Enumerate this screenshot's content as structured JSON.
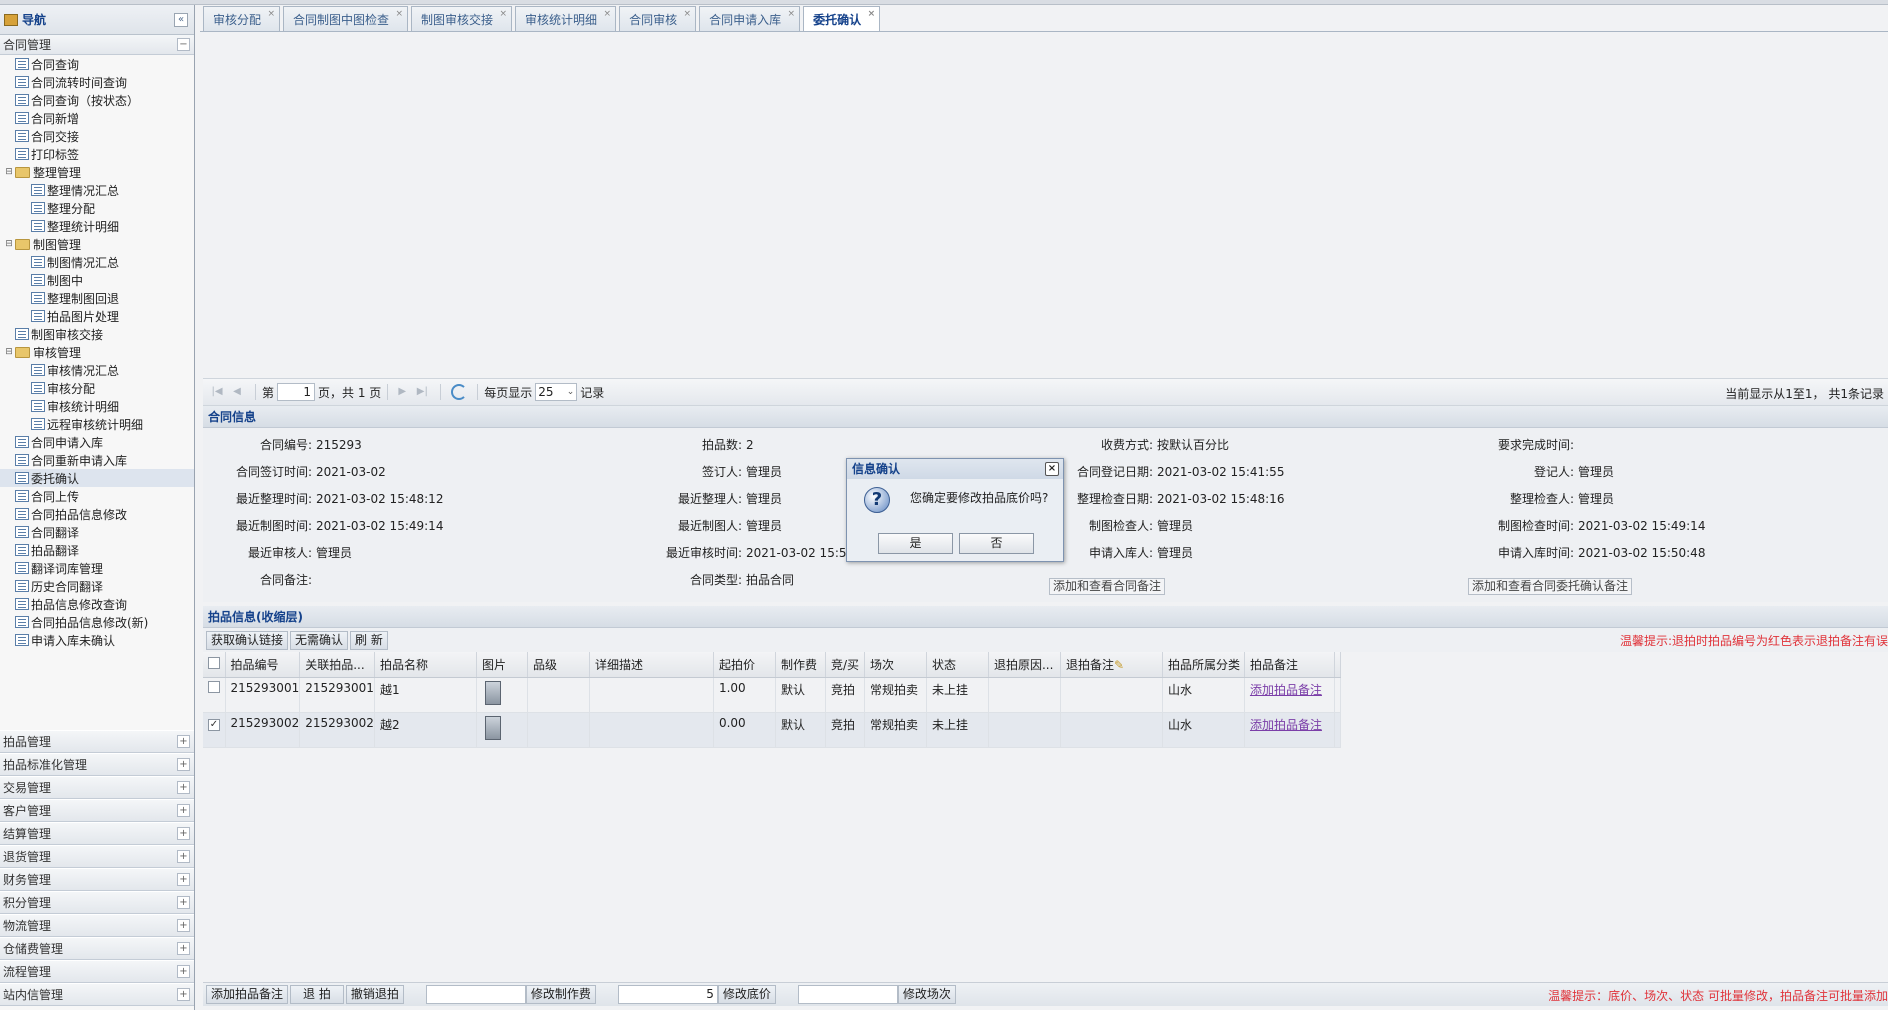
{
  "nav": {
    "title": "导航",
    "collapse_glyph": "«",
    "open_group": {
      "label": "合同管理",
      "toggle": "−"
    },
    "tree": [
      {
        "label": "合同查询",
        "level": 1,
        "type": "doc"
      },
      {
        "label": "合同流转时间查询",
        "level": 1,
        "type": "doc"
      },
      {
        "label": "合同查询（按状态）",
        "level": 1,
        "type": "doc"
      },
      {
        "label": "合同新增",
        "level": 1,
        "type": "doc"
      },
      {
        "label": "合同交接",
        "level": 1,
        "type": "doc"
      },
      {
        "label": "打印标签",
        "level": 1,
        "type": "doc"
      },
      {
        "label": "整理管理",
        "level": 1,
        "type": "folder"
      },
      {
        "label": "整理情况汇总",
        "level": 2,
        "type": "doc"
      },
      {
        "label": "整理分配",
        "level": 2,
        "type": "doc"
      },
      {
        "label": "整理统计明细",
        "level": 2,
        "type": "doc"
      },
      {
        "label": "制图管理",
        "level": 1,
        "type": "folder"
      },
      {
        "label": "制图情况汇总",
        "level": 2,
        "type": "doc"
      },
      {
        "label": "制图中",
        "level": 2,
        "type": "doc"
      },
      {
        "label": "整理制图回退",
        "level": 2,
        "type": "doc"
      },
      {
        "label": "拍品图片处理",
        "level": 2,
        "type": "doc"
      },
      {
        "label": "制图审核交接",
        "level": 1,
        "type": "doc"
      },
      {
        "label": "审核管理",
        "level": 1,
        "type": "folder"
      },
      {
        "label": "审核情况汇总",
        "level": 2,
        "type": "doc"
      },
      {
        "label": "审核分配",
        "level": 2,
        "type": "doc"
      },
      {
        "label": "审核统计明细",
        "level": 2,
        "type": "doc"
      },
      {
        "label": "远程审核统计明细",
        "level": 2,
        "type": "doc"
      },
      {
        "label": "合同申请入库",
        "level": 1,
        "type": "doc"
      },
      {
        "label": "合同重新申请入库",
        "level": 1,
        "type": "doc"
      },
      {
        "label": "委托确认",
        "level": 1,
        "type": "doc",
        "selected": true
      },
      {
        "label": "合同上传",
        "level": 1,
        "type": "doc"
      },
      {
        "label": "合同拍品信息修改",
        "level": 1,
        "type": "doc"
      },
      {
        "label": "合同翻译",
        "level": 1,
        "type": "doc"
      },
      {
        "label": "拍品翻译",
        "level": 1,
        "type": "doc"
      },
      {
        "label": "翻译词库管理",
        "level": 1,
        "type": "doc"
      },
      {
        "label": "历史合同翻译",
        "level": 1,
        "type": "doc"
      },
      {
        "label": "拍品信息修改查询",
        "level": 1,
        "type": "doc"
      },
      {
        "label": "合同拍品信息修改(新)",
        "level": 1,
        "type": "doc"
      },
      {
        "label": "申请入库未确认",
        "level": 1,
        "type": "doc"
      }
    ],
    "other_groups": [
      "拍品管理",
      "拍品标准化管理",
      "交易管理",
      "客户管理",
      "结算管理",
      "退货管理",
      "财务管理",
      "积分管理",
      "物流管理",
      "仓储费管理",
      "流程管理",
      "站内信管理"
    ],
    "expand_glyph": "+"
  },
  "tabs": [
    {
      "label": "审核分配",
      "active": false
    },
    {
      "label": "合同制图中图检查",
      "active": false
    },
    {
      "label": "制图审核交接",
      "active": false
    },
    {
      "label": "审核统计明细",
      "active": false
    },
    {
      "label": "合同审核",
      "active": false
    },
    {
      "label": "合同申请入库",
      "active": false
    },
    {
      "label": "委托确认",
      "active": true
    }
  ],
  "tab_close_glyph": "×",
  "pager": {
    "page_prefix": "第",
    "page_value": "1",
    "page_suffix": "页，共 1 页",
    "per_page_label": "每页显示",
    "per_page_value": "25",
    "records_label": "记录",
    "summary": "当前显示从1至1，  共1条记录"
  },
  "contract": {
    "title": "合同信息",
    "fields": [
      {
        "k": "合同编号:",
        "v": "215293",
        "col": 0,
        "row": 0
      },
      {
        "k": "拍品数:",
        "v": "2",
        "col": 1,
        "row": 0
      },
      {
        "k": "收费方式:",
        "v": "按默认百分比",
        "col": 2,
        "row": 0
      },
      {
        "k": "要求完成时间:",
        "v": "",
        "col": 3,
        "row": 0
      },
      {
        "k": "合同签订时间:",
        "v": "2021-03-02",
        "col": 0,
        "row": 1
      },
      {
        "k": "签订人:",
        "v": "管理员",
        "col": 1,
        "row": 1
      },
      {
        "k": "合同登记日期:",
        "v": "2021-03-02 15:41:55",
        "col": 2,
        "row": 1
      },
      {
        "k": "登记人:",
        "v": "管理员",
        "col": 3,
        "row": 1
      },
      {
        "k": "最近整理时间:",
        "v": "2021-03-02 15:48:12",
        "col": 0,
        "row": 2
      },
      {
        "k": "最近整理人:",
        "v": "管理员",
        "col": 1,
        "row": 2
      },
      {
        "k": "整理检查日期:",
        "v": "2021-03-02 15:48:16",
        "col": 2,
        "row": 2
      },
      {
        "k": "整理检查人:",
        "v": "管理员",
        "col": 3,
        "row": 2
      },
      {
        "k": "最近制图时间:",
        "v": "2021-03-02 15:49:14",
        "col": 0,
        "row": 3
      },
      {
        "k": "最近制图人:",
        "v": "管理员",
        "col": 1,
        "row": 3
      },
      {
        "k": "制图检查人:",
        "v": "管理员",
        "col": 2,
        "row": 3
      },
      {
        "k": "制图检查时间:",
        "v": "2021-03-02 15:49:14",
        "col": 3,
        "row": 3
      },
      {
        "k": "最近审核人:",
        "v": "管理员",
        "col": 0,
        "row": 4
      },
      {
        "k": "最近审核时间:",
        "v": "2021-03-02 15:50:30",
        "col": 1,
        "row": 4
      },
      {
        "k": "申请入库人:",
        "v": "管理员",
        "col": 2,
        "row": 4
      },
      {
        "k": "申请入库时间:",
        "v": "2021-03-02 15:50:48",
        "col": 3,
        "row": 4
      },
      {
        "k": "合同备注:",
        "v": "",
        "col": 0,
        "row": 5
      },
      {
        "k": "合同类型:",
        "v": "拍品合同",
        "col": 1,
        "row": 5
      }
    ],
    "btn_contract_note": "添加和查看合同备注",
    "btn_entrust_note": "添加和查看合同委托确认备注"
  },
  "items": {
    "title": "拍品信息(收缩层)",
    "toolbar": [
      "获取确认链接",
      "无需确认",
      "刷 新"
    ],
    "tip": "温馨提示:退拍时拍品编号为红色表示退拍备注有误",
    "columns": [
      "拍品编号",
      "关联拍品...",
      "拍品名称",
      "图片",
      "品级",
      "详细描述",
      "起拍价",
      "制作费",
      "竞/买",
      "场次",
      "状态",
      "退拍原因...",
      "退拍备注",
      "拍品所属分类",
      "拍品备注"
    ],
    "rows": [
      {
        "checked": false,
        "cells": [
          "215293001",
          "215293001",
          "越1",
          "",
          "",
          "",
          "1.00",
          "默认",
          "竞拍",
          "常规拍卖",
          "未上挂",
          "",
          "",
          "山水"
        ],
        "note": "添加拍品备注"
      },
      {
        "checked": true,
        "cells": [
          "215293002",
          "215293002",
          "越2",
          "",
          "",
          "",
          "0.00",
          "默认",
          "竞拍",
          "常规拍卖",
          "未上挂",
          "",
          "",
          "山水"
        ],
        "note": "添加拍品备注"
      }
    ]
  },
  "bottombar": {
    "btn_add_note": "添加拍品备注",
    "btn_withdraw": "退 拍",
    "btn_cancel_withdraw": "撤销退拍",
    "fee_value": "",
    "btn_fee": "修改制作费",
    "reserve_value": "5",
    "btn_reserve": "修改底价",
    "session_value": "",
    "btn_session": "修改场次",
    "tip": "温馨提示：底价、场次、状态 可批量修改，拍品备注可批量添加"
  },
  "dialog": {
    "title": "信息确认",
    "close": "×",
    "icon": "question-icon",
    "icon_glyph": "?",
    "message": "您确定要修改拍品底价吗?",
    "yes": "是",
    "no": "否"
  },
  "colors": {
    "title_blue": "#15428b",
    "tip_red": "#e0333a",
    "link_purple": "#7b3ea8"
  }
}
